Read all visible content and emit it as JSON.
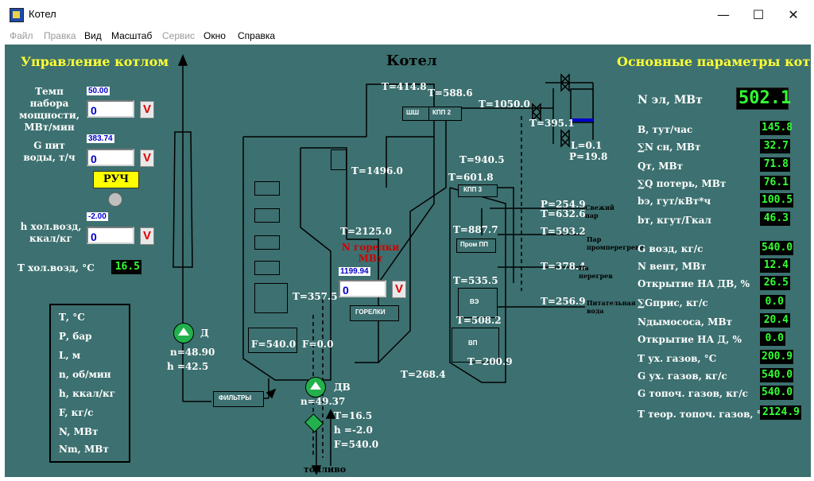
{
  "window": {
    "title": "Котел",
    "minimize": "—",
    "maximize": "☐",
    "close": "✕"
  },
  "menu": [
    {
      "label": "Файл",
      "enabled": false
    },
    {
      "label": "Правка",
      "enabled": false
    },
    {
      "label": "Вид",
      "enabled": true
    },
    {
      "label": "Масштаб",
      "enabled": true
    },
    {
      "label": "Сервис",
      "enabled": false
    },
    {
      "label": "Окно",
      "enabled": true
    },
    {
      "label": "Справка",
      "enabled": true
    }
  ],
  "left": {
    "heading": "Управление котлом",
    "rate_label": "Темп набора мощности, МВт/мин",
    "rate_set": "50.00",
    "rate_value": "0",
    "feedwater_label": "G пит воды, т/ч",
    "feedwater_set": "383.74",
    "feedwater_value": "0",
    "manual_button": "РУЧ",
    "cold_enthalpy_label": "h хол.возд, ккал/кг",
    "cold_enthalpy_set": "-2.00",
    "cold_enthalpy_value": "0",
    "cold_temp_label": "Т хол.возд, °С",
    "cold_temp_value": "16.5",
    "v_mark": "V"
  },
  "legend": [
    "Т, °С",
    "Р, бар",
    "L, м",
    "n, об/мин",
    "h, ккал/кг",
    "F, кг/с",
    "N, МВт",
    "Nm, МВт"
  ],
  "center": {
    "heading": "Котел",
    "burner_label": "N горелки МВт",
    "burner_set": "1199.94",
    "burner_value": "0",
    "burners_block": "ГОРЕЛКИ",
    "filter_block": "ФИЛЬТРЫ",
    "fuel_label": "топливо",
    "shsh": "ШШ",
    "kpp2": "КПП 2",
    "kpp3": "КПП 3",
    "prom_pp": "Пром ПП",
    "ve": "ВЭ",
    "vp": "ВП",
    "fan_d": "Д",
    "fan_dv": "ДВ",
    "d_n": "n=48.90",
    "d_h": "h =42.5",
    "dv_n": "n=49.37",
    "temps": {
      "t4148": "T=414.8",
      "t5886": "T=588.6",
      "t1050": "T=1050.0",
      "t3951": "T=395.1",
      "level": "L=0.1",
      "pressure": "P=19.8",
      "t1496": "T=1496.0",
      "t9405": "T=940.5",
      "t6018": "T=601.8",
      "p2549": "P=254.9",
      "t6326": "T=632.6",
      "t2125": "T=2125.0",
      "t8877": "T=887.7",
      "t5932": "T=593.2",
      "t3784": "T=378.4",
      "t5355": "T=535.5",
      "t3575": "T=357.5",
      "t2569": "T=256.9",
      "t5082": "T=508.2",
      "f540": "F=540.0",
      "f0": "F=0.0",
      "t2684": "T=268.4",
      "t2009": "T=200.9",
      "t165": "T=16.5",
      "h20": "h =-2.0",
      "f540b": "F=540.0"
    },
    "notes": {
      "fresh_steam": "Свежий пар",
      "reheat_steam": "Пар промперегрева",
      "to_reheat": "На перегрев",
      "feed_water": "Питательная вода"
    }
  },
  "right": {
    "heading": "Основные параметры котла",
    "n_el_label": "N эл, МВт",
    "n_el_value": "502.1",
    "params": [
      {
        "label": "B, тут/час",
        "value": "145.8"
      },
      {
        "label": "∑N сн, МВт",
        "value": "32.7"
      },
      {
        "label": "Qт, МВт",
        "value": "71.8"
      },
      {
        "label": "∑Q потерь, МВт",
        "value": "76.1"
      },
      {
        "label": "bэ, гут/кВт*ч",
        "value": "100.5"
      },
      {
        "label": "bт, кгут/Гкал",
        "value": "46.3"
      },
      {
        "label": "G возд, кг/с",
        "value": "540.0"
      },
      {
        "label": "N вент, МВт",
        "value": "12.4"
      },
      {
        "label": "Открытие НА ДВ, %",
        "value": "26.5"
      },
      {
        "label": "∑Gприс, кг/с",
        "value": "0.0"
      },
      {
        "label": "Nдымососа, МВт",
        "value": "20.4"
      },
      {
        "label": "Открытие НА Д, %",
        "value": "0.0"
      },
      {
        "label": "Т ух. газов, °С",
        "value": "200.9"
      },
      {
        "label": "G ух. газов, кг/с",
        "value": "540.0"
      },
      {
        "label": "G топоч. газов, кг/с",
        "value": "540.0"
      },
      {
        "label": "Т теор. топоч. газов, °С",
        "value": "2124.9"
      }
    ]
  }
}
